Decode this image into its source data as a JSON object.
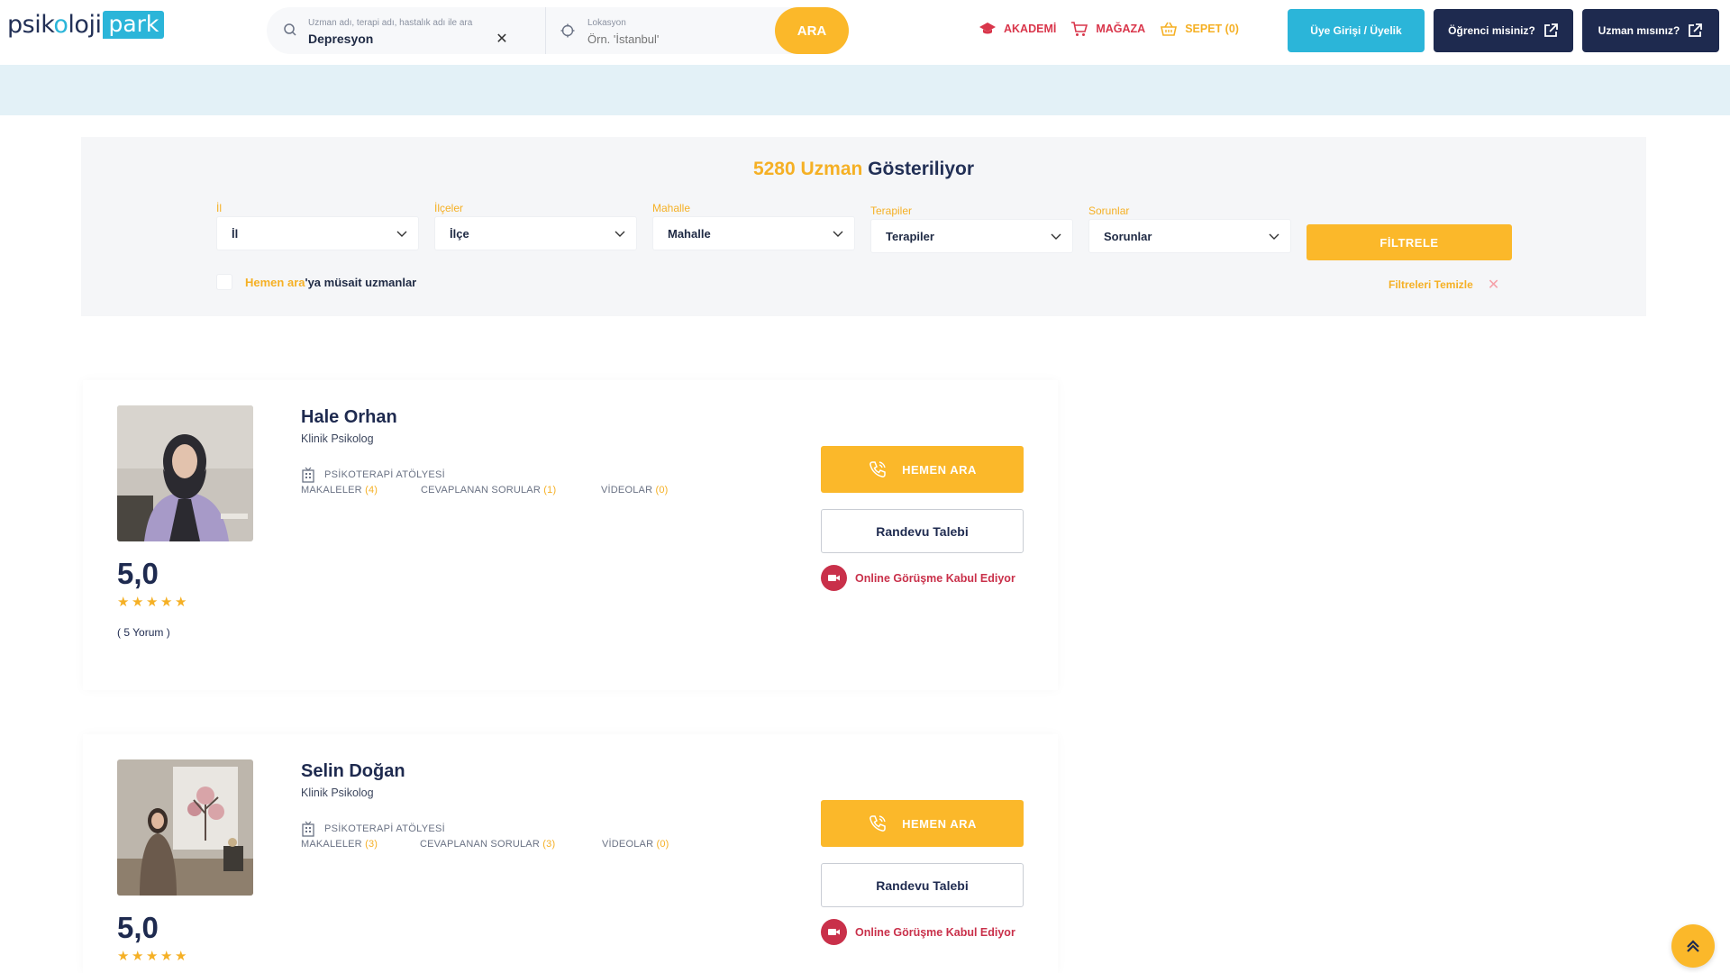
{
  "brand": {
    "logo_left": "psik",
    "logo_o": "o",
    "logo_mid": "loji",
    "logo_right": "park"
  },
  "search": {
    "query_label": "Uzman adı, terapi adı, hastalık adı ile ara",
    "query_value": "Depresyon",
    "location_label": "Lokasyon",
    "location_placeholder": "Örn. 'İstanbul'",
    "submit_label": "ARA"
  },
  "nav": {
    "academy": "AKADEMİ",
    "store": "MAĞAZA",
    "cart": "SEPET (0)"
  },
  "header_buttons": {
    "login": "Üye Girişi / Üyelik",
    "student": "Öğrenci misiniz?",
    "expert": "Uzman mısınız?"
  },
  "filters": {
    "count": "5280 Uzman",
    "count_suffix": " Gösteriliyor",
    "groups": [
      {
        "label": "İl",
        "value": "İl"
      },
      {
        "label": "İlçeler",
        "value": "İlçe"
      },
      {
        "label": "Mahalle",
        "value": "Mahalle"
      },
      {
        "label": "Terapiler",
        "value": "Terapiler"
      },
      {
        "label": "Sorunlar",
        "value": "Sorunlar"
      }
    ],
    "submit_label": "FİLTRELE",
    "available_highlight": "Hemen ara",
    "available_rest": "'ya müsait uzmanlar",
    "clear_label": "Filtreleri Temizle"
  },
  "experts": [
    {
      "name": "Hale Orhan",
      "title": "Klinik Psikolog",
      "workshop": "PSİKOTERAPİ ATÖLYESİ",
      "articles_label": "MAKALELER",
      "articles_count": "(4)",
      "questions_label": "CEVAPLANAN SORULAR",
      "questions_count": "(1)",
      "videos_label": "VİDEOLAR",
      "videos_count": "(0)",
      "rating": "5,0",
      "stars": 5,
      "reviews": "( 5 Yorum )",
      "call_label": "HEMEN ARA",
      "appointment_label": "Randevu Talebi",
      "online_label": "Online Görüşme Kabul Ediyor"
    },
    {
      "name": "Selin Doğan",
      "title": "Klinik Psikolog",
      "workshop": "PSİKOTERAPİ ATÖLYESİ",
      "articles_label": "MAKALELER",
      "articles_count": "(3)",
      "questions_label": "CEVAPLANAN SORULAR",
      "questions_count": "(3)",
      "videos_label": "VİDEOLAR",
      "videos_count": "(0)",
      "rating": "5,0",
      "stars": 5,
      "call_label": "HEMEN ARA",
      "appointment_label": "Randevu Talebi",
      "online_label": "Online Görüşme Kabul Ediyor"
    }
  ],
  "colors": {
    "accent": "#fbb82a",
    "brand_blue": "#2bb5d9",
    "navy": "#1e2a4f",
    "red": "#c9304a"
  }
}
